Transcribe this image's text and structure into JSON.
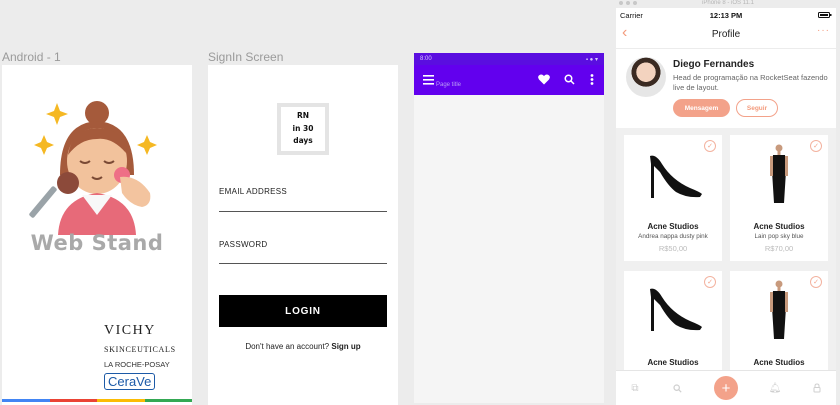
{
  "frames": {
    "android": "Android - 1",
    "signin": "SignIn Screen",
    "third": "",
    "iphone": "iPhone 8 - iOS 11.1"
  },
  "android_screen": {
    "brand": "Web Stand",
    "brands": {
      "vichy": "VICHY",
      "skinceuticals": "SKINCEUTICALS",
      "roche_posay": "LA ROCHE-POSAY",
      "cerave": "CeraVe"
    },
    "strip_colors": [
      "#4285f4",
      "#ea4335",
      "#fbbc05",
      "#34a853"
    ]
  },
  "signin": {
    "logo": "RN\nin 30\ndays",
    "email_label": "EMAIL ADDRESS",
    "password_label": "PASSWORD",
    "login_label": "LOGIN",
    "signup_prompt": "Don't have an account?",
    "signup_link": "Sign up"
  },
  "third_screen": {
    "status_time": "8:00",
    "app_title_ghost": "Page title",
    "icons": [
      "menu-icon",
      "heart-icon",
      "search-icon",
      "more-vert-icon"
    ],
    "accent": "#6200ee"
  },
  "ios": {
    "carrier": "Carrier",
    "time": "12:13 PM",
    "title": "Profile",
    "profile": {
      "name": "Diego Fernandes",
      "bio": "Head de programação na RocketSeat fazendo live de layout.",
      "message_button": "Mensagem",
      "follow_button": "Seguir"
    },
    "products": [
      {
        "title": "Acne Studios",
        "subtitle": "Andrea nappa dusty pink",
        "price": "R$50,00",
        "kind": "heel"
      },
      {
        "title": "Acne Studios",
        "subtitle": "Lain pop sky blue",
        "price": "R$70,00",
        "kind": "dress"
      },
      {
        "title": "Acne Studios",
        "subtitle": "",
        "price": "",
        "kind": "heel"
      },
      {
        "title": "Acne Studios",
        "subtitle": "",
        "price": "",
        "kind": "dress"
      }
    ],
    "tabs": [
      "copy-icon",
      "search-icon",
      "add-icon",
      "bell-icon",
      "lock-icon"
    ],
    "accent": "#f3a28a"
  }
}
